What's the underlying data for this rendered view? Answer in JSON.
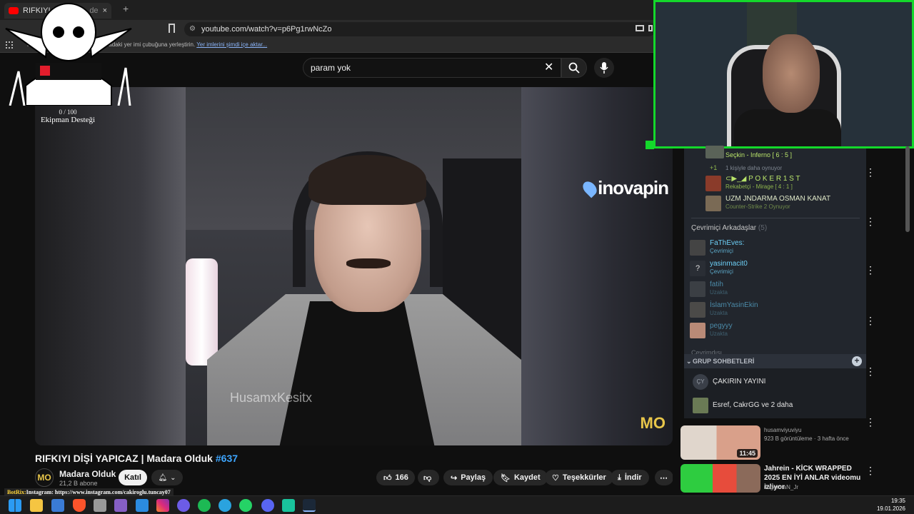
{
  "browser": {
    "tab_title": "RIFKIYI D",
    "tab_title_rest": "de",
    "url": "youtube.com/watch?v=p6Pg1rwNcZo",
    "bookmarks_text": "Hızlı erişim için yer imlerinizi buradaki yer imi çubuğuna yerleştirin.",
    "bookmarks_link": "Yer imlerini şimdi içe aktar..."
  },
  "overlay": {
    "goal_count": "0 / 100",
    "goal_label": "Ekipman Desteği",
    "botrix_prefix": "BotRix:",
    "botrix_text": "Instagram: https://www.instagram.com/cakiroglu.tuncay07"
  },
  "youtube": {
    "search_value": "param yok",
    "video": {
      "sponsor": "inovapin",
      "watermark": "HusamxKesitx",
      "corner_logo": "MO",
      "title": "RIFKIYI DİŞİ YAPICAZ | Madara Olduk",
      "hashtag": "#637"
    },
    "channel": {
      "avatar": "MO",
      "name": "Madara Olduk",
      "subs": "21,2 B abone",
      "join_label": "Katıl"
    },
    "actions": {
      "likes": "166",
      "share": "Paylaş",
      "save": "Kaydet",
      "thanks": "Teşekkürler",
      "download": "İndir"
    },
    "recommendations": [
      {
        "title": "husamviyuviyu",
        "meta": "923 B görüntüleme · 3 hafta önce",
        "duration": "11:45"
      },
      {
        "title": "Jahrein - KİCK WRAPPED 2025 EN İYİ ANLAR videomu izliyor",
        "meta": "JagermaN_Jr"
      }
    ]
  },
  "steam": {
    "ingame": [
      {
        "name": "",
        "status": "Seçkin - Inferno [ 6 : 5 ]"
      },
      {
        "name": "+1",
        "status": "1 kişiyle daha oynuyor"
      },
      {
        "name": "⊂▶_◢ P O K E R 1 S T",
        "status": "Rekabetçi - Mirage [ 4 : 1 ]"
      },
      {
        "name": "UZM JNDARMA OSMAN KANAT",
        "status": "Counter-Strike 2 Oynuyor"
      }
    ],
    "online_header": "Çevrimiçi Arkadaşlar",
    "online_count": "(5)",
    "friends": [
      {
        "name": "FaThEves:",
        "status": "Çevrimiçi",
        "state": "online"
      },
      {
        "name": "yasinmacit0",
        "status": "Çevrimiçi",
        "state": "online"
      },
      {
        "name": "fatih",
        "status": "Uzakta",
        "state": "away"
      },
      {
        "name": "İslamYasinEkin",
        "status": "Uzakta",
        "state": "away"
      },
      {
        "name": "pegyyy",
        "status": "Uzakta",
        "state": "away"
      }
    ],
    "offline_header": "Çevrimdışı",
    "groups_header": "GRUP SOHBETLERİ",
    "groups": [
      {
        "icon": "ÇY",
        "name": "ÇAKIRIN YAYINI"
      },
      {
        "icon": "",
        "name": "Esref, CakrGG ve 2 daha"
      }
    ]
  },
  "taskbar": {
    "time": "19:35",
    "date": "19.01.2026"
  },
  "colors": {
    "accent_green": "#14d82b",
    "yt_link": "#3ea6ff",
    "steam_online": "#6dcff6",
    "steam_ingame": "#b9e46a"
  }
}
